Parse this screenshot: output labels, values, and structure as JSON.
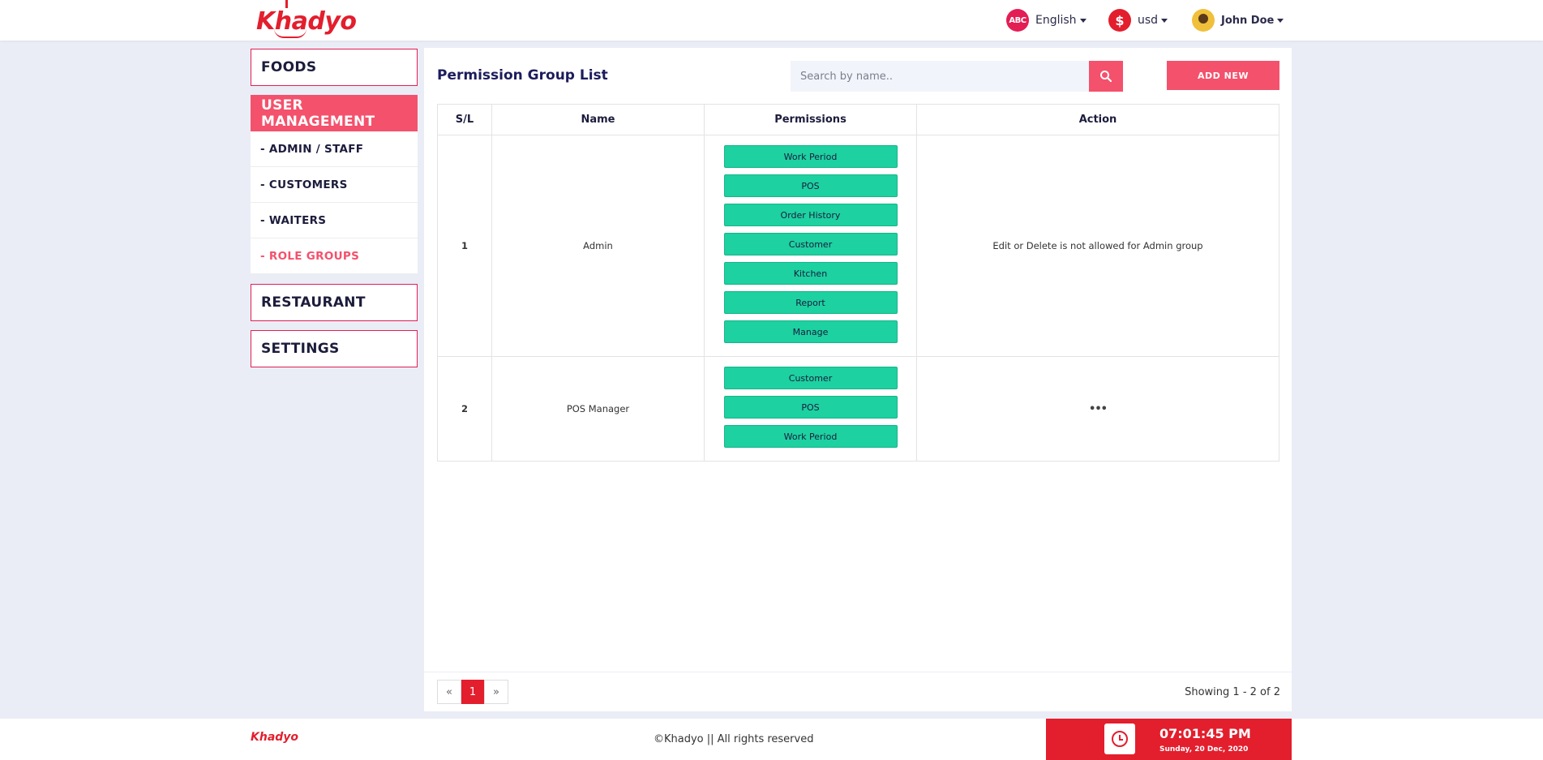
{
  "header": {
    "logo": "Khadyo",
    "language": {
      "icon": "ABC",
      "label": "English"
    },
    "currency": {
      "icon": "$",
      "label": "usd"
    },
    "user": {
      "name": "John Doe"
    }
  },
  "sidebar": {
    "sections": [
      {
        "label": "FOODS"
      },
      {
        "label": "USER MANAGEMENT"
      },
      {
        "label": "RESTAURANT"
      },
      {
        "label": "SETTINGS"
      }
    ],
    "sub_items": [
      {
        "label": "- ADMIN / STAFF"
      },
      {
        "label": "- CUSTOMERS"
      },
      {
        "label": "- WAITERS"
      },
      {
        "label": "- ROLE GROUPS"
      }
    ]
  },
  "main": {
    "title": "Permission Group List",
    "search_placeholder": "Search by name..",
    "add_button": "ADD NEW",
    "columns": [
      "S/L",
      "Name",
      "Permissions",
      "Action"
    ],
    "rows": [
      {
        "sl": "1",
        "name": "Admin",
        "permissions": [
          "Work Period",
          "POS",
          "Order History",
          "Customer",
          "Kitchen",
          "Report",
          "Manage"
        ],
        "action": "Edit or Delete is not allowed for Admin group"
      },
      {
        "sl": "2",
        "name": "POS Manager",
        "permissions": [
          "Customer",
          "POS",
          "Work Period"
        ],
        "action": "•••"
      }
    ]
  },
  "pagination": {
    "prev": "«",
    "page": "1",
    "next": "»",
    "showing": "Showing 1 - 2 of 2"
  },
  "footer": {
    "logo": "Khadyo",
    "copyright": "©Khadyo || All rights reserved",
    "time": "07:01:45 PM",
    "date": "Sunday, 20 Dec, 2020"
  },
  "colors": {
    "accent": "#f4516c",
    "brand": "#e31e2d",
    "permission": "#1dd1a1"
  }
}
